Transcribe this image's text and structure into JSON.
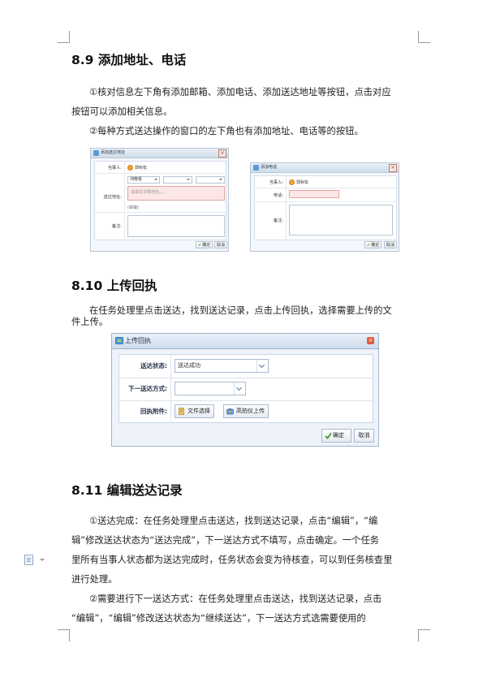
{
  "section_8_9": {
    "heading": "8.9  添加地址、电话",
    "para1_line1": "①核对信息左下角有添加邮箱、添加电话、添加送达地址等按钮，点击对应",
    "para1_line2": "按钮可以添加相关信息。",
    "para2": "②每种方式送达操作的窗口的左下角也有添加地址、电话等的按钮。"
  },
  "dialog_address": {
    "title": "添加送达地址",
    "party_label": "当事人:",
    "party_value": "郭秋松",
    "address_label": "送达地址:",
    "province": "河南省",
    "detail_placeholder": "请填写详细地址。。。",
    "postcode": "(邮编)",
    "remark_label": "备注:",
    "ok_label": "确定",
    "cancel_label": "取消"
  },
  "dialog_phone": {
    "title": "添加电话",
    "party_label": "当事人:",
    "party_value": "郭秋松",
    "phone_label": "电话:",
    "remark_label": "备注:",
    "ok_label": "确定",
    "cancel_label": "取消"
  },
  "section_8_10": {
    "heading": "8.10  上传回执",
    "para_line1": "在任务处理里点击送达，找到送达记录，点击上传回执，选择需要上传的文",
    "para_line2": "件上传。"
  },
  "upload_dialog": {
    "title": "上传回执",
    "status_label": "送达状态:",
    "status_value": "送达成功",
    "next_method_label": "下一送达方式:",
    "next_method_value": "",
    "attachment_label": "回执附件:",
    "file_button": "文件选择",
    "scanner_button": "高拍仪上传",
    "ok_label": "确定",
    "cancel_label": "取消"
  },
  "section_8_11": {
    "heading": "8.11  编辑送达记录",
    "p1_l1": "①送达完成：在任务处理里点击送达，找到送达记录，点击“编辑”，“编",
    "p1_l2": "辑”修改送达状态为“送达完成”，下一送达方式不填写，点击确定。一个任务",
    "p1_l3": "里所有当事人状态都为送达完成时，任务状态会变为待核查，可以到任务核查里",
    "p1_l4": "进行处理。",
    "p2_l1": "②需要进行下一送达方式：在任务处理里点击送达，找到送达记录，点击",
    "p2_l2": "“编辑”，“编辑”修改送达状态为“继续送达”，下一送达方式选需要使用的"
  }
}
